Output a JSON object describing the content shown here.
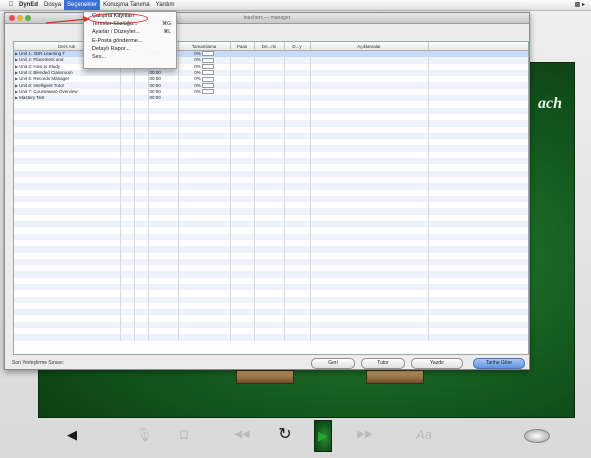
{
  "menubar": {
    "app": "DynEd",
    "items": [
      "Dosya",
      "Seçenekler",
      "Konuşma Tanıma",
      "Yardım"
    ],
    "selected_index": 1
  },
  "window": {
    "title": "teachers — manager"
  },
  "dropdown": {
    "items": [
      {
        "label": "Çalışma Kayıtları",
        "shortcut": ""
      },
      {
        "label": "Terimler Sözlüğü...",
        "shortcut": "⌘G"
      },
      {
        "label": "Ayarlar / Düzeyler...",
        "shortcut": "⌘L"
      },
      {
        "label": "E-Posta gönderme...",
        "shortcut": ""
      },
      {
        "label": "Detaylı Rapor...",
        "shortcut": ""
      },
      {
        "label": "Ses...",
        "shortcut": ""
      }
    ]
  },
  "table": {
    "columns": [
      "Ders Adı",
      "",
      "",
      "",
      "Tamamlama",
      "Puan",
      "De...mi",
      "D...y",
      "Açıklamalar"
    ],
    "rows": [
      {
        "name": "Unit 1: 3DR Learning T",
        "time": "00:00",
        "completion": "0%"
      },
      {
        "name": "Unit 2: Placement and",
        "time": "00:00",
        "completion": "0%"
      },
      {
        "name": "Unit 3: How to Study",
        "time": "00:00",
        "completion": "0%"
      },
      {
        "name": "Unit 4: Blended Classroom",
        "time": "00:00",
        "completion": "0%"
      },
      {
        "name": "Unit 5: Records Manager",
        "time": "00:00",
        "completion": "0%"
      },
      {
        "name": "Unit 6: Intelligent Tutor",
        "time": "00:00",
        "completion": "0%"
      },
      {
        "name": "Unit 7: Courseware Overview",
        "time": "00:00",
        "completion": "0%"
      },
      {
        "name": "Mastery Test",
        "time": "00:00",
        "completion": ""
      }
    ]
  },
  "buttons": {
    "back": "Geri",
    "tutor": "Tutor",
    "print": "Yazdır",
    "sort_by_date": "Tarihe Göre"
  },
  "status": "Son Yerleştirme Sınavı:",
  "background_title": "ach",
  "accent_colors": {
    "selected_menu": "#3d6fd8",
    "annotation": "#d7332a",
    "play": "#1faa2c"
  },
  "icons": [
    "apple-icon",
    "back-icon",
    "microphone-icon",
    "headphones-icon",
    "rewind-icon",
    "repeat-icon",
    "play-icon",
    "fast-forward-icon",
    "text-size-icon",
    "globe-icon"
  ],
  "text_size_label": "Aa"
}
